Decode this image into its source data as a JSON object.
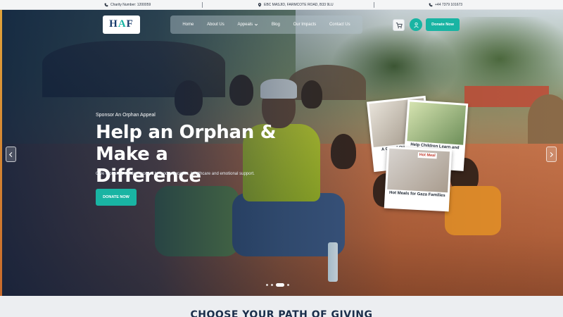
{
  "topbar": {
    "charity_number": "Charity Number: 1200059",
    "address": "EBC MASJID, FARMCOTE ROAD, B33 9LU",
    "phone": "+44 7379 101673"
  },
  "logo": {
    "text": "HAF"
  },
  "nav": {
    "items": [
      "Home",
      "About Us",
      "Appeals",
      "Blog",
      "Our Impacts",
      "Contact Us"
    ],
    "donate_label": "Donate Now"
  },
  "hero": {
    "eyebrow": "Sponsor An Orphan Appeal",
    "headline": "Help an Orphan & Make a Difference",
    "description": "Give orphaned children access to food, education, healthcare and emotional support.",
    "cta_label": "DONATE NOW",
    "cards": [
      "A Gift of Qur'an and Learning",
      "Help Children Learn and Grow",
      "Hot Meals for Gaza Families"
    ],
    "card_badge": "Hot Meal",
    "active_slide": 3,
    "slide_count": 4
  },
  "section": {
    "title": "CHOOSE YOUR PATH OF GIVING"
  },
  "colors": {
    "accent": "#19b4a3",
    "navy": "#163a6b",
    "heading": "#1b2e4a"
  },
  "icons": [
    "phone-icon",
    "location-icon",
    "cart-icon",
    "user-icon",
    "chevron-left-icon",
    "chevron-right-icon",
    "chevron-down-icon"
  ]
}
